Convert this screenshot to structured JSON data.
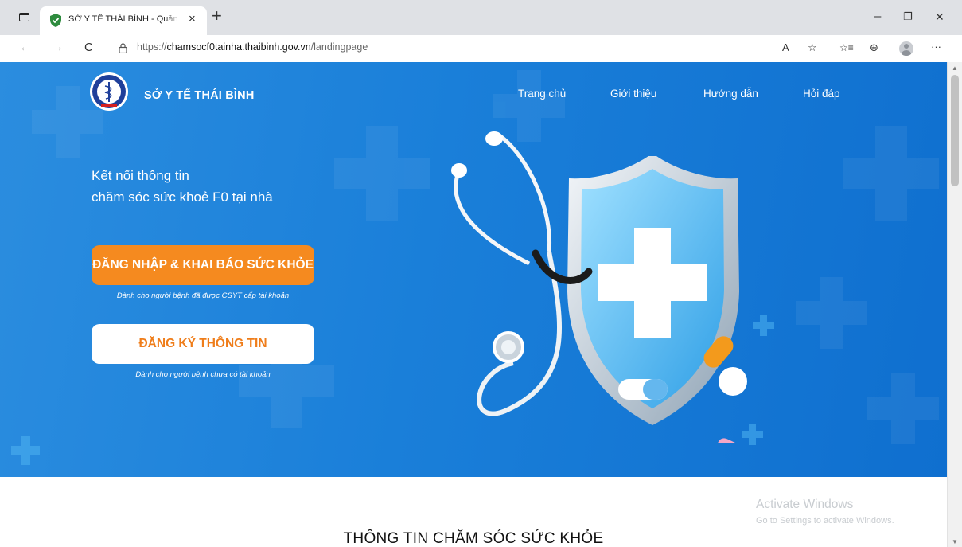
{
  "browser": {
    "tab_title": "SỞ Y TẾ THÁI BÌNH - Quản lý người bệnh",
    "tab_close": "×",
    "new_tab": "+",
    "url_scheme": "https://",
    "url_host": "chamsocf0tainha.thaibinh.gov.vn",
    "url_path": "/landingpage",
    "controls": {
      "minimize": "–",
      "restore": "❐",
      "close": "✕"
    },
    "nav": {
      "back": "←",
      "forward": "→",
      "refresh": "C"
    },
    "tools": {
      "read_aloud": "A",
      "favorite": "☆",
      "favorites": "☆≡",
      "collections": "⊕",
      "more": "···"
    }
  },
  "header": {
    "brand": "SỞ Y TẾ THÁI BÌNH",
    "nav": [
      "Trang chủ",
      "Giới thiệu",
      "Hướng dẫn",
      "Hỏi đáp"
    ]
  },
  "hero": {
    "tagline_line1": "Kết nối thông tin",
    "tagline_line2": "chăm sóc sức khoẻ F0 tại nhà",
    "login_button": "ĐĂNG NHẬP & KHAI BÁO SỨC KHỎE",
    "login_note": "Dành cho người bệnh đã được CSYT cấp tài khoản",
    "register_button": "ĐĂNG KÝ THÔNG TIN",
    "register_note": "Dành cho người bệnh chưa có tài khoản"
  },
  "section": {
    "title": "THÔNG TIN CHĂM SÓC SỨC KHỎE"
  },
  "watermark": {
    "line1": "Activate Windows",
    "line2": "Go to Settings to activate Windows."
  },
  "icons": {
    "favicon": "shield-check-icon",
    "logo": "caduceus-logo-icon",
    "illustration": "stethoscope-shield-icon"
  },
  "colors": {
    "hero_blue": "#1a7fd9",
    "accent_orange": "#f58a1f",
    "favicon_green": "#2e8b3e"
  }
}
